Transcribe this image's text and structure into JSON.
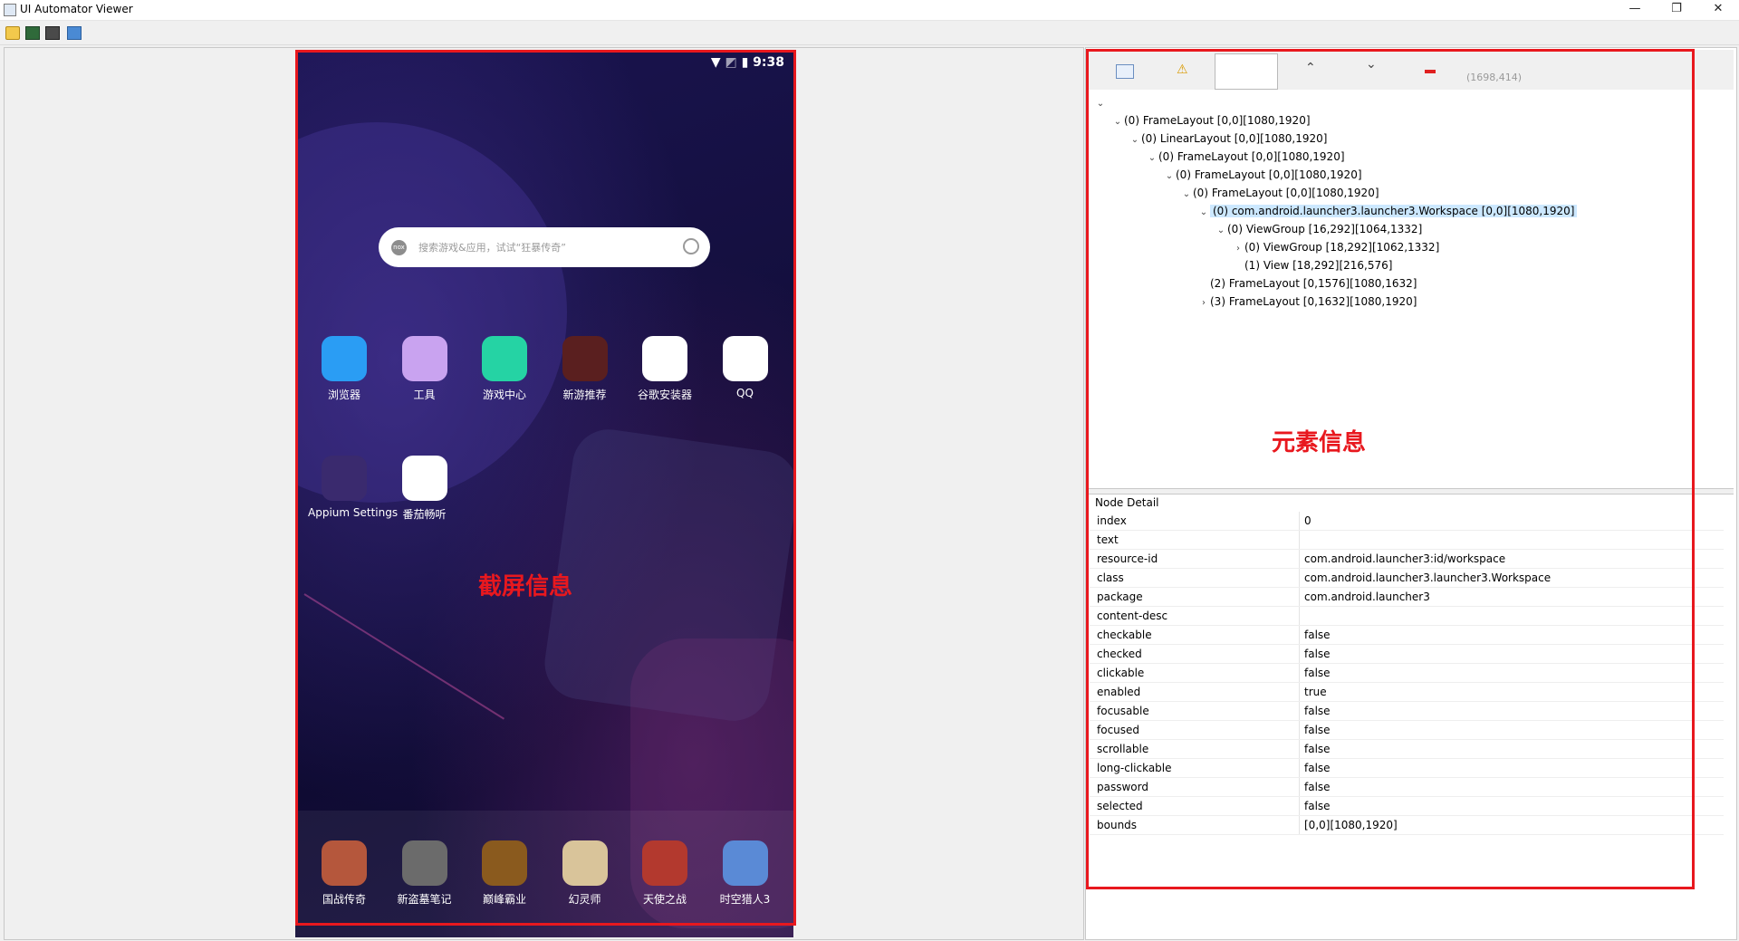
{
  "window": {
    "title": "UI Automator Viewer",
    "minimize": "—",
    "restore": "❐",
    "close": "✕"
  },
  "toolbar": {
    "icons": [
      "open-folder-icon",
      "device-screenshot-icon",
      "device-screenshot-compressed-icon",
      "save-icon"
    ]
  },
  "device": {
    "status_time": "9:38",
    "search_placeholder": "搜索游戏&应用，试试“狂暴传奇”",
    "search_logo": "nox",
    "apps_row1": [
      {
        "label": "浏览器",
        "icon": "browser-icon",
        "color": "#2a9df4"
      },
      {
        "label": "工具",
        "icon": "tools-icon",
        "color": "#c9a3f0"
      },
      {
        "label": "游戏中心",
        "icon": "game-center-icon",
        "color": "#25d3a4"
      },
      {
        "label": "新游推荐",
        "icon": "new-games-icon",
        "color": "#5a1f1f"
      },
      {
        "label": "谷歌安装器",
        "icon": "google-installer-icon",
        "color": "#ffffff"
      },
      {
        "label": "QQ",
        "icon": "qq-icon",
        "color": "#ffffff"
      }
    ],
    "apps_row2": [
      {
        "label": "Appium Settings",
        "icon": "appium-settings-icon",
        "color": "#3a2a6e"
      },
      {
        "label": "番茄畅听",
        "icon": "fanqie-icon",
        "color": "#ffffff"
      }
    ],
    "dock": [
      {
        "label": "国战传奇",
        "icon": "guozhan-icon",
        "color": "#b5573c"
      },
      {
        "label": "新盗墓笔记",
        "icon": "daomu-icon",
        "color": "#6b6b6b"
      },
      {
        "label": "巅峰霸业",
        "icon": "dianfeng-icon",
        "color": "#8a5a1e"
      },
      {
        "label": "幻灵师",
        "icon": "huanling-icon",
        "color": "#d9c49a"
      },
      {
        "label": "天使之战",
        "icon": "tianshi-icon",
        "color": "#b3392e"
      },
      {
        "label": "时空猎人3",
        "icon": "shikong-icon",
        "color": "#5a8ad6"
      }
    ]
  },
  "annotations": {
    "screenshot": "截屏信息",
    "element": "元素信息"
  },
  "tree_toolbar": {
    "coords": "(1698,414)",
    "icons": [
      "expand-all-icon",
      "warning-icon",
      "filter-box",
      "up-arrow-icon",
      "down-arrow-icon",
      "remove-icon"
    ]
  },
  "tree": [
    {
      "depth": 0,
      "arrow": "⌄",
      "text": "",
      "selected": false
    },
    {
      "depth": 1,
      "arrow": "⌄",
      "text": "(0) FrameLayout [0,0][1080,1920]",
      "selected": false
    },
    {
      "depth": 2,
      "arrow": "⌄",
      "text": "(0) LinearLayout [0,0][1080,1920]",
      "selected": false
    },
    {
      "depth": 3,
      "arrow": "⌄",
      "text": "(0) FrameLayout [0,0][1080,1920]",
      "selected": false
    },
    {
      "depth": 4,
      "arrow": "⌄",
      "text": "(0) FrameLayout [0,0][1080,1920]",
      "selected": false
    },
    {
      "depth": 5,
      "arrow": "⌄",
      "text": "(0) FrameLayout [0,0][1080,1920]",
      "selected": false
    },
    {
      "depth": 6,
      "arrow": "⌄",
      "text": "(0) com.android.launcher3.launcher3.Workspace [0,0][1080,1920]",
      "selected": true
    },
    {
      "depth": 7,
      "arrow": "⌄",
      "text": "(0) ViewGroup [16,292][1064,1332]",
      "selected": false
    },
    {
      "depth": 8,
      "arrow": "›",
      "text": "(0) ViewGroup [18,292][1062,1332]",
      "selected": false
    },
    {
      "depth": 8,
      "arrow": "",
      "text": "(1) View [18,292][216,576]",
      "selected": false
    },
    {
      "depth": 6,
      "arrow": "",
      "text": "(2) FrameLayout [0,1576][1080,1632]",
      "selected": false
    },
    {
      "depth": 6,
      "arrow": "›",
      "text": "(3) FrameLayout [0,1632][1080,1920]",
      "selected": false
    }
  ],
  "detail": {
    "title": "Node Detail",
    "rows": [
      {
        "k": "index",
        "v": "0"
      },
      {
        "k": "text",
        "v": ""
      },
      {
        "k": "resource-id",
        "v": "com.android.launcher3:id/workspace"
      },
      {
        "k": "class",
        "v": "com.android.launcher3.launcher3.Workspace"
      },
      {
        "k": "package",
        "v": "com.android.launcher3"
      },
      {
        "k": "content-desc",
        "v": ""
      },
      {
        "k": "checkable",
        "v": "false"
      },
      {
        "k": "checked",
        "v": "false"
      },
      {
        "k": "clickable",
        "v": "false"
      },
      {
        "k": "enabled",
        "v": "true"
      },
      {
        "k": "focusable",
        "v": "false"
      },
      {
        "k": "focused",
        "v": "false"
      },
      {
        "k": "scrollable",
        "v": "false"
      },
      {
        "k": "long-clickable",
        "v": "false"
      },
      {
        "k": "password",
        "v": "false"
      },
      {
        "k": "selected",
        "v": "false"
      },
      {
        "k": "bounds",
        "v": "[0,0][1080,1920]"
      }
    ]
  }
}
